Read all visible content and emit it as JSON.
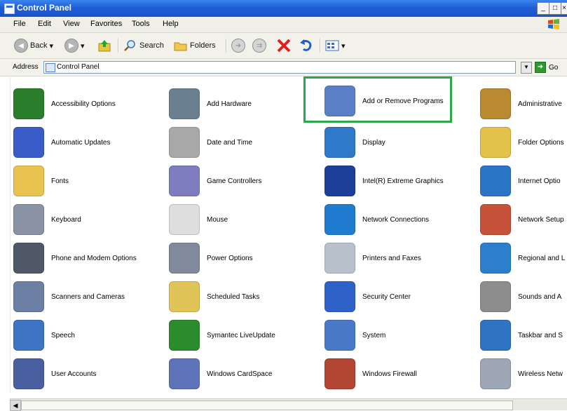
{
  "window": {
    "title": "Control Panel",
    "buttons": {
      "minimize": "_",
      "maximize": "□",
      "close": "×"
    }
  },
  "menu": [
    "File",
    "Edit",
    "View",
    "Favorites",
    "Tools",
    "Help"
  ],
  "toolbar": {
    "back_label": "Back",
    "search_label": "Search",
    "folders_label": "Folders"
  },
  "address": {
    "label": "Address",
    "value": "Control Panel",
    "go_label": "Go"
  },
  "items": [
    {
      "label": "Accessibility Options",
      "icon": "accessibility-icon",
      "color": "#2a7d2a"
    },
    {
      "label": "Add Hardware",
      "icon": "add-hardware-icon",
      "color": "#6a7f8f"
    },
    {
      "label": "Add or Remove Programs",
      "icon": "add-remove-programs-icon",
      "color": "#5b7fc6"
    },
    {
      "label": "Administrative",
      "icon": "administrative-tools-icon",
      "color": "#b98a32"
    },
    {
      "label": "Automatic Updates",
      "icon": "automatic-updates-icon",
      "color": "#3a5cc9"
    },
    {
      "label": "Date and Time",
      "icon": "date-time-icon",
      "color": "#a8a8a8"
    },
    {
      "label": "Display",
      "icon": "display-icon",
      "color": "#2f79c8"
    },
    {
      "label": "Folder Options",
      "icon": "folder-options-icon",
      "color": "#e3c14a"
    },
    {
      "label": "Fonts",
      "icon": "fonts-icon",
      "color": "#e8c34f"
    },
    {
      "label": "Game Controllers",
      "icon": "game-controllers-icon",
      "color": "#7d7dbf"
    },
    {
      "label": "Intel(R) Extreme Graphics",
      "icon": "intel-graphics-icon",
      "color": "#1c3f9a"
    },
    {
      "label": "Internet Optio",
      "icon": "internet-options-icon",
      "color": "#2c74c6"
    },
    {
      "label": "Keyboard",
      "icon": "keyboard-icon",
      "color": "#8a93a6"
    },
    {
      "label": "Mouse",
      "icon": "mouse-icon",
      "color": "#dedede"
    },
    {
      "label": "Network Connections",
      "icon": "network-connections-icon",
      "color": "#1f7ccf"
    },
    {
      "label": "Network Setup",
      "icon": "network-setup-icon",
      "color": "#c6523a"
    },
    {
      "label": "Phone and Modem Options",
      "icon": "phone-modem-icon",
      "color": "#4e5866"
    },
    {
      "label": "Power Options",
      "icon": "power-options-icon",
      "color": "#808a9b"
    },
    {
      "label": "Printers and Faxes",
      "icon": "printers-faxes-icon",
      "color": "#b8c1cc"
    },
    {
      "label": "Regional and L",
      "icon": "regional-language-icon",
      "color": "#2b7fcc"
    },
    {
      "label": "Scanners and Cameras",
      "icon": "scanners-cameras-icon",
      "color": "#6c7fa4"
    },
    {
      "label": "Scheduled Tasks",
      "icon": "scheduled-tasks-icon",
      "color": "#e0c457"
    },
    {
      "label": "Security Center",
      "icon": "security-center-icon",
      "color": "#2f62c9"
    },
    {
      "label": "Sounds and A",
      "icon": "sounds-audio-icon",
      "color": "#8d8d8d"
    },
    {
      "label": "Speech",
      "icon": "speech-icon",
      "color": "#3e74c4"
    },
    {
      "label": "Symantec LiveUpdate",
      "icon": "symantec-liveupdate-icon",
      "color": "#2c8b2c"
    },
    {
      "label": "System",
      "icon": "system-icon",
      "color": "#4a78c9"
    },
    {
      "label": "Taskbar and S",
      "icon": "taskbar-startmenu-icon",
      "color": "#2f73c3"
    },
    {
      "label": "User Accounts",
      "icon": "user-accounts-icon",
      "color": "#4a5fa0"
    },
    {
      "label": "Windows CardSpace",
      "icon": "windows-cardspace-icon",
      "color": "#5f74b8"
    },
    {
      "label": "Windows Firewall",
      "icon": "windows-firewall-icon",
      "color": "#b44634"
    },
    {
      "label": "Wireless Netw",
      "icon": "wireless-network-icon",
      "color": "#9da7b5"
    }
  ]
}
